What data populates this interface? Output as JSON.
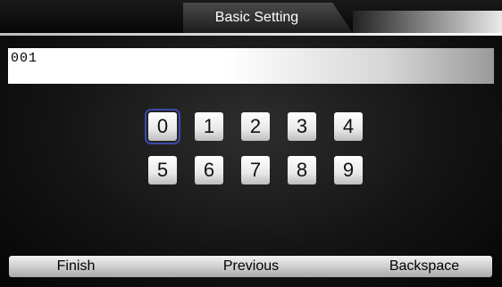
{
  "header": {
    "title": "Basic Setting"
  },
  "input": {
    "value": "001"
  },
  "keypad": {
    "row1": [
      "0",
      "1",
      "2",
      "3",
      "4"
    ],
    "row2": [
      "5",
      "6",
      "7",
      "8",
      "9"
    ],
    "selected_key": "0"
  },
  "footer": {
    "finish_label": "Finish",
    "previous_label": "Previous",
    "backspace_label": "Backspace"
  }
}
